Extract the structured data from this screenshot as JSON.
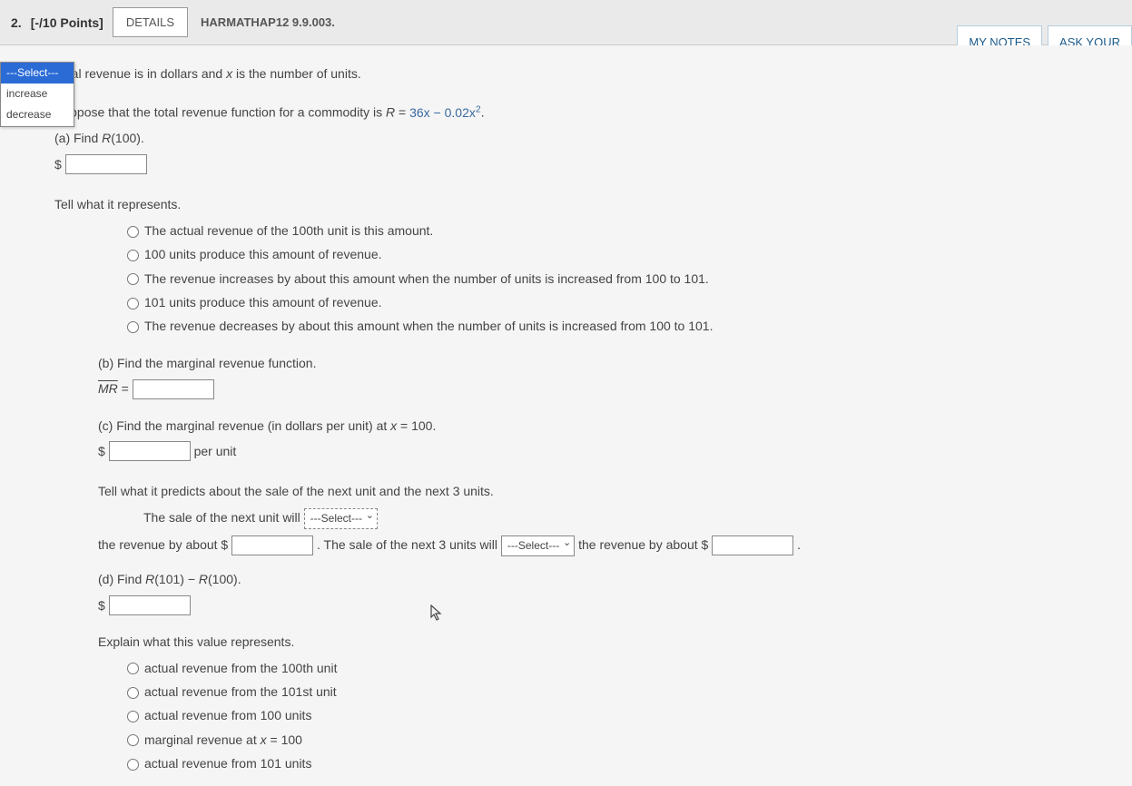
{
  "header": {
    "q_num": "2.",
    "points": "[-/10 Points]",
    "details_btn": "DETAILS",
    "source": "HARMATHAP12 9.9.003.",
    "my_notes_btn": "MY NOTES",
    "ask_btn": "ASK YOUR"
  },
  "intro1": "Total revenue is in dollars and ",
  "intro1b": " is the number of units.",
  "intro2a": "Suppose that the total revenue function for a commodity is ",
  "intro2b": "R",
  "intro2c": " = ",
  "intro2d": "36x − 0.02x",
  "intro2e": "2",
  "intro2f": ".",
  "partA": {
    "q": "(a) Find R(100).",
    "dollar": "$",
    "tell": "Tell what it represents.",
    "opts": [
      "The actual revenue of the 100th unit is this amount.",
      "100 units produce this amount of revenue.",
      "The revenue increases by about this amount when the number of units is increased from 100 to 101.",
      "101 units produce this amount of revenue.",
      "The revenue decreases by about this amount when the number of units is increased from 100 to 101."
    ]
  },
  "partB": {
    "q": "(b) Find the marginal revenue function.",
    "label": "MR",
    "eq": " ="
  },
  "partC": {
    "q1": "(c) Find the marginal revenue (in dollars per unit) at ",
    "q2": "x",
    "q3": " = 100.",
    "dollar": "$",
    "after": " per unit",
    "tell": "Tell what it predicts about the sale of the next unit and the next 3 units.",
    "line1a": "The sale of the next unit will ",
    "line1b": " the revenue by about $",
    "line1c": " . The sale of the next 3 units will ",
    "line1d": " the revenue by about $",
    "line1e": " .",
    "select_label": "---Select---",
    "dd": {
      "placeholder": "---Select---",
      "opt1": "increase",
      "opt2": "decrease"
    }
  },
  "partD": {
    "q": "(d) Find R(101) − R(100).",
    "dollar": "$",
    "tell": "Explain what this value represents.",
    "opts": [
      "actual revenue from the 100th unit",
      "actual revenue from the 101st unit",
      "actual revenue from 100 units",
      "marginal revenue at x = 100",
      "actual revenue from 101 units"
    ]
  }
}
